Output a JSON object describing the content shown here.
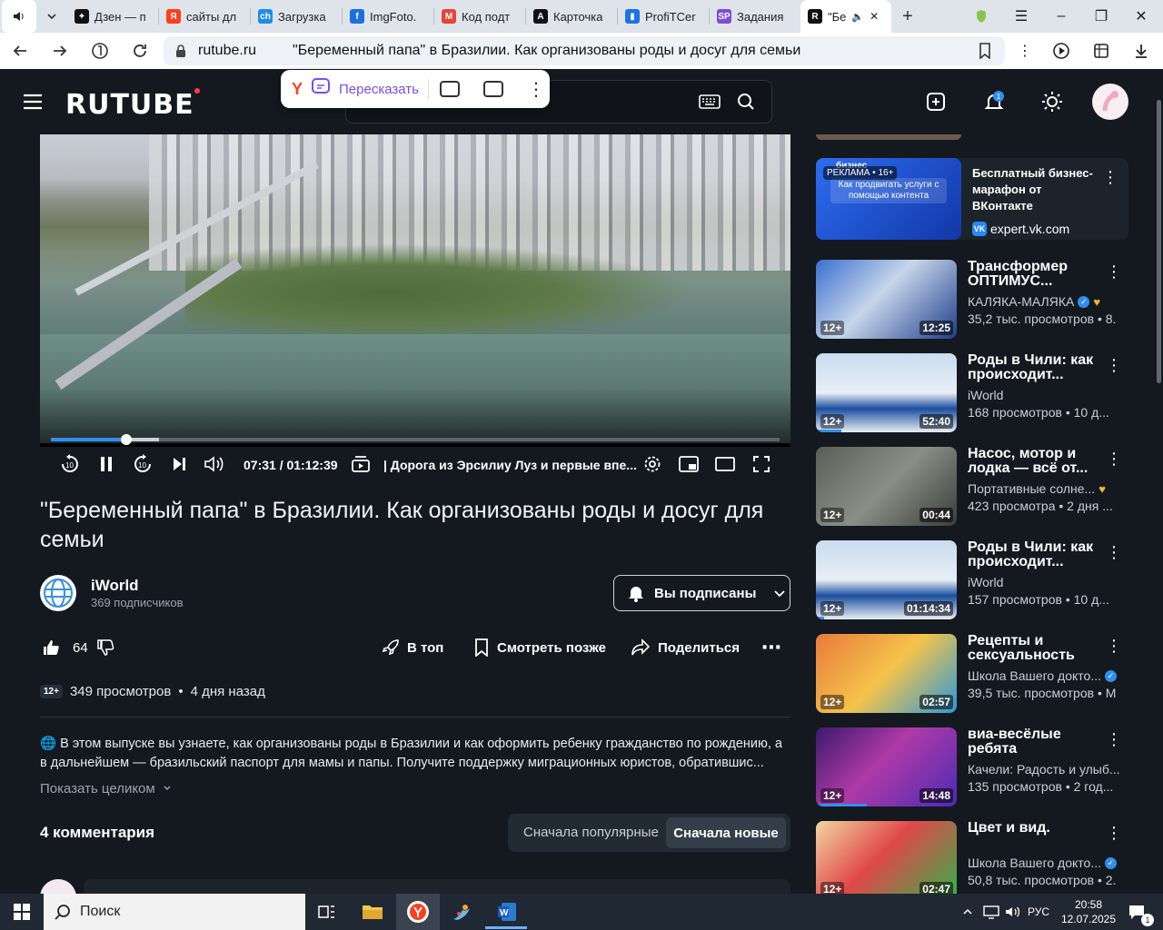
{
  "browser": {
    "tabs": [
      {
        "label": "Дзен — п",
        "favicon_color": "#111111",
        "favicon_glyph": "✦"
      },
      {
        "label": "сайты дл",
        "favicon_color": "#fc3f1d",
        "favicon_glyph": "Я"
      },
      {
        "label": "Загрузка",
        "favicon_color": "#1f8ceb",
        "favicon_glyph": "ch"
      },
      {
        "label": "ImgFoto.",
        "favicon_color": "#1d6fe0",
        "favicon_glyph": "f"
      },
      {
        "label": "Код подт",
        "favicon_color": "#ea4335",
        "favicon_glyph": "M"
      },
      {
        "label": "Карточка",
        "favicon_color": "#111111",
        "favicon_glyph": "A"
      },
      {
        "label": "ProfiTCer",
        "favicon_color": "#1a73e8",
        "favicon_glyph": "▮"
      },
      {
        "label": "Задания",
        "favicon_color": "#7d4bd6",
        "favicon_glyph": "SP"
      },
      {
        "label": "\"Бе",
        "favicon_color": "#111111",
        "favicon_glyph": "R"
      }
    ],
    "url_domain": "rutube.ru",
    "page_title": "\"Беременный папа\" в Бразилии. Как организованы роды и досуг для семьи"
  },
  "popup": {
    "retell_label": "Пересказать"
  },
  "player": {
    "timecode": "07:31 / 01:12:39",
    "chapter": "| Дорога из Эрсилиу Луз и первые впе...",
    "progress_fraction": 0.103
  },
  "video": {
    "title": "\"Беременный папа\" в Бразилии. Как организованы роды и досуг для семьи",
    "channel_name": "iWorld",
    "channel_subs": "369 подписчиков",
    "subscribe_label": "Вы подписаны",
    "likes": "64",
    "to_top_label": "В топ",
    "watch_later_label": "Смотреть позже",
    "share_label": "Поделиться",
    "age": "12+",
    "views": "349 просмотров",
    "posted": "4 дня назад",
    "description": "🌐 В этом выпуске вы узнаете, как организованы роды в Бразилии и как оформить ребенку гражданство по рождению, а в дальнейшем — бразильский паспорт для мамы и папы. Получите поддержку миграционных юристов, обратившис...",
    "show_all": "Показать целиком",
    "comments_count": "4 комментария",
    "sort_popular": "Сначала популярные",
    "sort_new": "Сначала новые"
  },
  "ad": {
    "badge": "РЕКЛАМА • 16+",
    "thumb_brand": "бизнес",
    "thumb_text": "Как продвигать услуги с помощью контента",
    "title": "Бесплатный бизнес-марафон от ВКонтакте",
    "source": "expert.vk.com"
  },
  "recommendations": [
    {
      "title": "Трансформер ОПТИМУС...",
      "channel": "КАЛЯКА-МАЛЯКА",
      "verified": true,
      "heart": true,
      "stats": "35,2 тыс. просмотров • 8.",
      "age": "12+",
      "duration": "12:25",
      "watched": 0.0,
      "thumb_bg": "linear-gradient(135deg,#3a6fd0,#c7d6ea 45%,#1d3d8a)"
    },
    {
      "title": "Роды в Чили: как происходит...",
      "channel": "iWorld",
      "verified": false,
      "heart": false,
      "stats": "168 просмотров • 10 д...",
      "age": "12+",
      "duration": "52:40",
      "watched": 0.18,
      "thumb_bg": "linear-gradient(180deg,#c9dcef,#e8eef5 50%,#1c4fa0 70%,#e9eef4)"
    },
    {
      "title": "Насос, мотор и лодка — всё от...",
      "channel": "Портативные солне...",
      "verified": false,
      "heart": true,
      "stats": "423 просмотра • 2 дня ...",
      "age": "12+",
      "duration": "00:44",
      "watched": 0.0,
      "thumb_bg": "linear-gradient(135deg,#5a5e58,#8a8f86 50%,#3a3d39)"
    },
    {
      "title": "Роды в Чили: как происходит...",
      "channel": "iWorld",
      "verified": false,
      "heart": false,
      "stats": "157 просмотров • 10 д...",
      "age": "12+",
      "duration": "01:14:34",
      "watched": 0.06,
      "thumb_bg": "linear-gradient(180deg,#c9dcef,#e8eef5 50%,#1c4fa0 70%,#e9eef4)"
    },
    {
      "title": "Рецепты и сексуальность",
      "channel": "Школа Вашего докто...",
      "verified": true,
      "heart": false,
      "stats": "39,5 тыс. просмотров • М",
      "age": "12+",
      "duration": "02:57",
      "watched": 0.0,
      "thumb_bg": "linear-gradient(135deg,#e97a3c,#f4c34a 50%,#2b9ad8)"
    },
    {
      "title": "виа-весёлые ребята",
      "channel": "Качели: Радость и улыб...",
      "verified": false,
      "heart": false,
      "stats": "135 просмотров • 2 год...",
      "age": "12+",
      "duration": "14:48",
      "watched": 0.36,
      "thumb_bg": "linear-gradient(135deg,#3b1a6e,#b03aa6 45%,#4b2bb5)"
    },
    {
      "title": "Цвет и вид.",
      "channel": "Школа Вашего докто...",
      "verified": true,
      "heart": false,
      "stats": "50,8 тыс. просмотров • 2.",
      "age": "12+",
      "duration": "02:47",
      "watched": 0.0,
      "thumb_bg": "linear-gradient(135deg,#f2d6a2,#e04848 45%,#33b04a)"
    }
  ],
  "notifications_count": "1",
  "taskbar": {
    "search_label": "Поиск",
    "lang": "РУС",
    "time": "20:58",
    "date": "12.07.2025",
    "notify_count": "1"
  }
}
